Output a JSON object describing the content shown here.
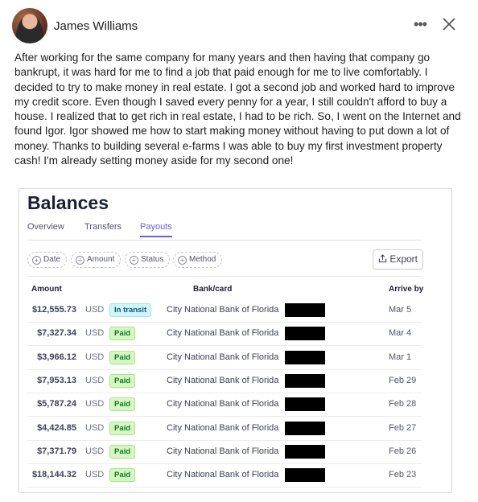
{
  "post": {
    "author": "James Williams",
    "text": "After working for the same company for many years and then having that company go bankrupt, it was hard for me to find a job that paid enough for me to live comfortably. I decided to try to make money in real estate. I got a second job and worked hard to improve my credit score. Even though I saved every penny for a year, I still couldn't afford to buy a house. I realized that to get rich in real estate, I had to be rich. So, I went on the Internet and found Igor. Igor showed me how to start making money without having to put down a lot of money. Thanks to building several e-farms I was able to buy my first investment property cash! I'm already setting money aside for my second one!",
    "more_label": "•••",
    "close_icon": "close-icon"
  },
  "balances": {
    "title": "Balances",
    "tabs": [
      "Overview",
      "Transfers",
      "Payouts"
    ],
    "active_tab": "Payouts",
    "filters": [
      "Date",
      "Amount",
      "Status",
      "Method"
    ],
    "export_label": "Export",
    "columns": {
      "amount": "Amount",
      "bank": "Bank/card",
      "arrive": "Arrive by"
    },
    "rows": [
      {
        "amount": "$12,555.73",
        "currency": "USD",
        "status": "In transit",
        "bank": "City National Bank of Florida",
        "date": "Mar 5"
      },
      {
        "amount": "$7,327.34",
        "currency": "USD",
        "status": "Paid",
        "bank": "City National Bank of Florida",
        "date": "Mar 4"
      },
      {
        "amount": "$3,966.12",
        "currency": "USD",
        "status": "Paid",
        "bank": "City National Bank of Florida",
        "date": "Mar 1"
      },
      {
        "amount": "$7,953.13",
        "currency": "USD",
        "status": "Paid",
        "bank": "City National Bank of Florida",
        "date": "Feb 29"
      },
      {
        "amount": "$5,787.24",
        "currency": "USD",
        "status": "Paid",
        "bank": "City National Bank of Florida",
        "date": "Feb 28"
      },
      {
        "amount": "$4,424.85",
        "currency": "USD",
        "status": "Paid",
        "bank": "City National Bank of Florida",
        "date": "Feb 27"
      },
      {
        "amount": "$7,371.79",
        "currency": "USD",
        "status": "Paid",
        "bank": "City National Bank of Florida",
        "date": "Feb 26"
      },
      {
        "amount": "$18,144.32",
        "currency": "USD",
        "status": "Paid",
        "bank": "City National Bank of Florida",
        "date": "Feb 23"
      }
    ]
  },
  "colors": {
    "accent": "#635bff",
    "paid_bg": "#d7f7c2",
    "transit_bg": "#cff5f6"
  }
}
